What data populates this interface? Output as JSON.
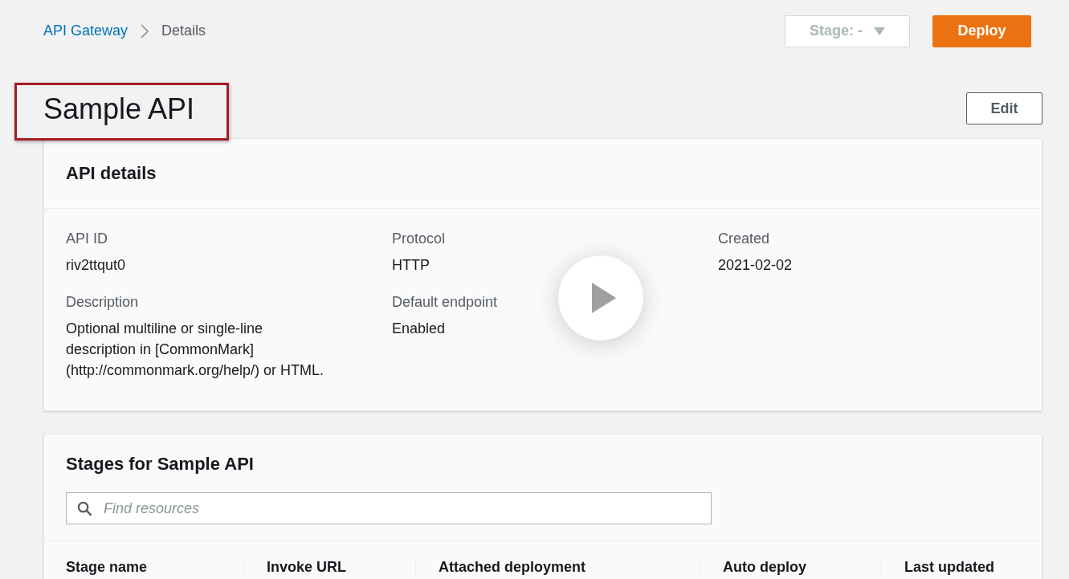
{
  "breadcrumb": [
    {
      "label": "API Gateway",
      "kind": "link"
    },
    {
      "label": "Details",
      "kind": "current"
    }
  ],
  "stage_select": {
    "label": "Stage: -",
    "disabled": true
  },
  "deploy_button": "Deploy",
  "title": "Sample API",
  "edit_button": "Edit",
  "api_details": {
    "heading": "API details",
    "fields": [
      {
        "label": "API ID",
        "value": "riv2ttqut0"
      },
      {
        "label": "Protocol",
        "value": "HTTP"
      },
      {
        "label": "Created",
        "value": "2021-02-02"
      },
      {
        "label": "Description",
        "value": "Optional multiline or single-line description in [CommonMark] (http://commonmark.org/help/) or HTML."
      },
      {
        "label": "Default endpoint",
        "value": "Enabled"
      }
    ]
  },
  "stages": {
    "heading": "Stages for Sample API",
    "search": {
      "placeholder": "Find resources"
    },
    "table": {
      "columns": [
        "Stage name",
        "Invoke URL",
        "Attached deployment",
        "Auto deploy",
        "Last updated"
      ]
    }
  }
}
